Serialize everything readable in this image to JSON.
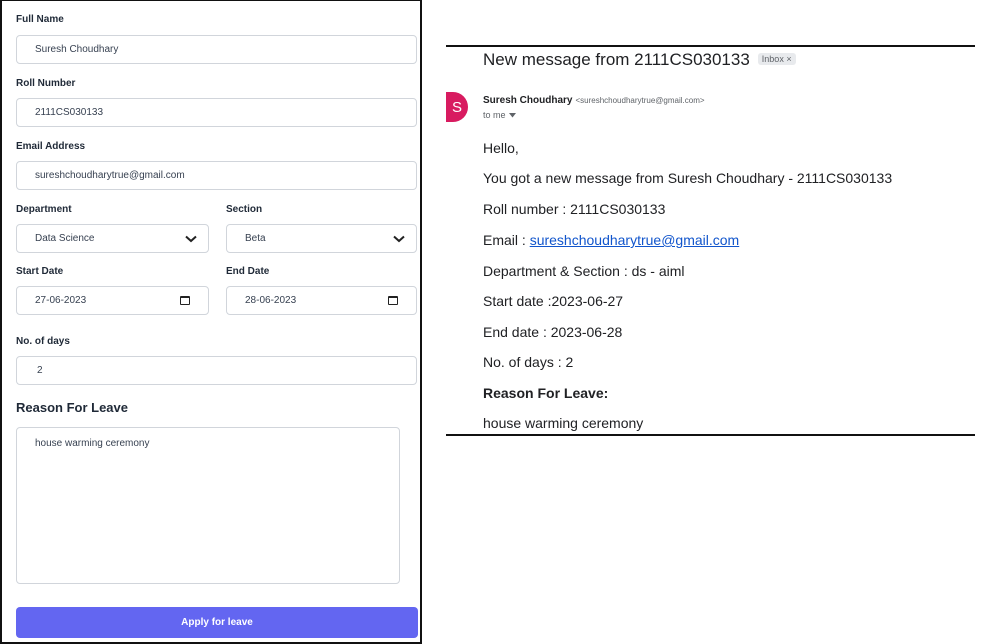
{
  "form": {
    "full_name": {
      "label": "Full Name",
      "value": "Suresh Choudhary"
    },
    "roll_number": {
      "label": "Roll Number",
      "value": "2111CS030133"
    },
    "email": {
      "label": "Email Address",
      "value": "sureshchoudharytrue@gmail.com"
    },
    "department": {
      "label": "Department",
      "value": "Data Science"
    },
    "section": {
      "label": "Section",
      "value": "Beta"
    },
    "start_date": {
      "label": "Start Date",
      "value": "27-06-2023"
    },
    "end_date": {
      "label": "End Date",
      "value": "28-06-2023"
    },
    "days": {
      "label": "No. of days",
      "value": "2"
    },
    "reason": {
      "heading": "Reason For Leave",
      "value": "house warming ceremony"
    },
    "submit_label": "Apply for leave"
  },
  "email": {
    "subject": "New message from 2111CS030133",
    "badge": "Inbox ×",
    "avatar_letter": "S",
    "avatar_color": "#d81b60",
    "sender_name": "Suresh Choudhary",
    "sender_email": "<sureshchoudharytrue@gmail.com>",
    "to_me": "to me",
    "body": {
      "greeting": "Hello,",
      "intro": "You got a new message from Suresh Choudhary - 2111CS030133",
      "roll": "Roll number : 2111CS030133",
      "email_prefix": "Email : ",
      "email_link": "sureshchoudharytrue@gmail.com",
      "dept_section": "Department & Section : ds - aiml",
      "start": "Start date :2023-06-27",
      "end": "End date : 2023-06-28",
      "days": "No. of days : 2",
      "reason_heading": "Reason For Leave:",
      "reason": "house warming ceremony"
    }
  },
  "colors": {
    "accent_button": "#6366f1",
    "link": "#1155cc"
  }
}
